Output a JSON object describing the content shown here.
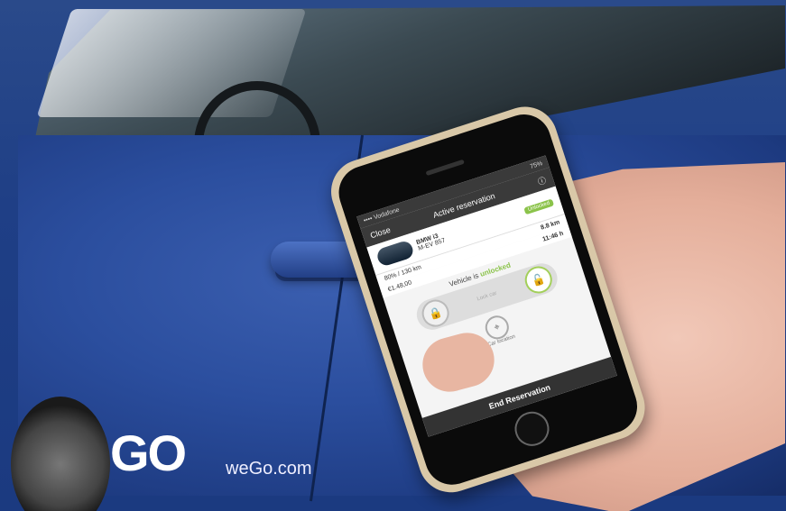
{
  "scene": {
    "logo_text": "GO",
    "logo_url": "weGo.com"
  },
  "app": {
    "status_left": "•••• Vodafone",
    "status_right": "75%",
    "nav_close": "Close",
    "nav_title": "Active reservation",
    "car_name": "BMW i3",
    "car_plate": "M-EV 857",
    "badge": "Unlocked",
    "distance": "8.8 km",
    "metric_range": "80% / 130 km",
    "metric_cost": "€1.48,00",
    "metric_time": "11:46 h",
    "vehicle_status_prefix": "Vehicle is",
    "vehicle_status_word": "unlocked",
    "lock_text": "Lock car",
    "car_location_label": "Car location",
    "end_button": "End Reservation"
  }
}
